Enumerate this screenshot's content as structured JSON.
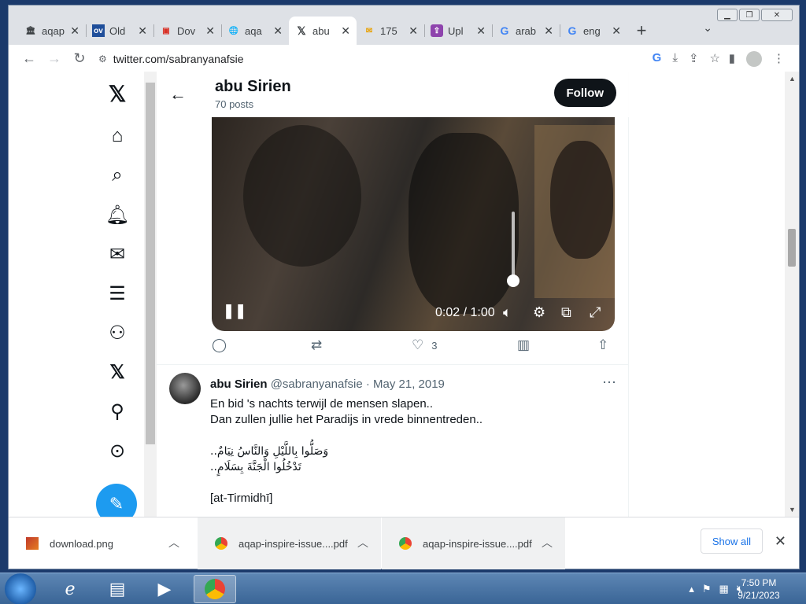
{
  "browser": {
    "tabs": [
      {
        "label": "aqap",
        "favicon": "institution-icon"
      },
      {
        "label": "Old",
        "favicon": "ov-icon"
      },
      {
        "label": "Dov",
        "favicon": "pdf-icon"
      },
      {
        "label": "aqa",
        "favicon": "globe-icon"
      },
      {
        "label": "abu",
        "favicon": "x-icon",
        "active": true
      },
      {
        "label": "175",
        "favicon": "mail-icon"
      },
      {
        "label": "Upl",
        "favicon": "upload-icon"
      },
      {
        "label": "arab",
        "favicon": "google-icon"
      },
      {
        "label": "eng",
        "favicon": "google-icon"
      }
    ],
    "url": "twitter.com/sabranyanafsie"
  },
  "profile_header": {
    "name": "abu Sirien",
    "posts": "70 posts",
    "follow_label": "Follow"
  },
  "video": {
    "time": "0:02 / 1:00",
    "volume_level": 0.1
  },
  "video_tweet_actions": {
    "likes": "3"
  },
  "tweet": {
    "author": "abu Sirien",
    "handle": "@sabranyanafsie",
    "date": "· May 21, 2019",
    "lines": [
      "En bid 's nachts terwijl de mensen slapen..",
      "Dan zullen jullie het Paradijs in vrede binnentreden..",
      "",
      "وَصَلُّوا بِاللَّيْلِ وَالنَّاسُ نِيَامٌ..",
      "تَدْخُلُوا الْجَنَّةَ بِسَلَامٍ..",
      "",
      "[at-Tirmidhī]"
    ]
  },
  "downloads": {
    "items": [
      {
        "name": "download.png"
      },
      {
        "name": "aqap-inspire-issue....pdf"
      },
      {
        "name": "aqap-inspire-issue....pdf"
      }
    ],
    "show_all": "Show all"
  },
  "taskbar": {
    "time": "7:50 PM",
    "date": "9/21/2023"
  }
}
